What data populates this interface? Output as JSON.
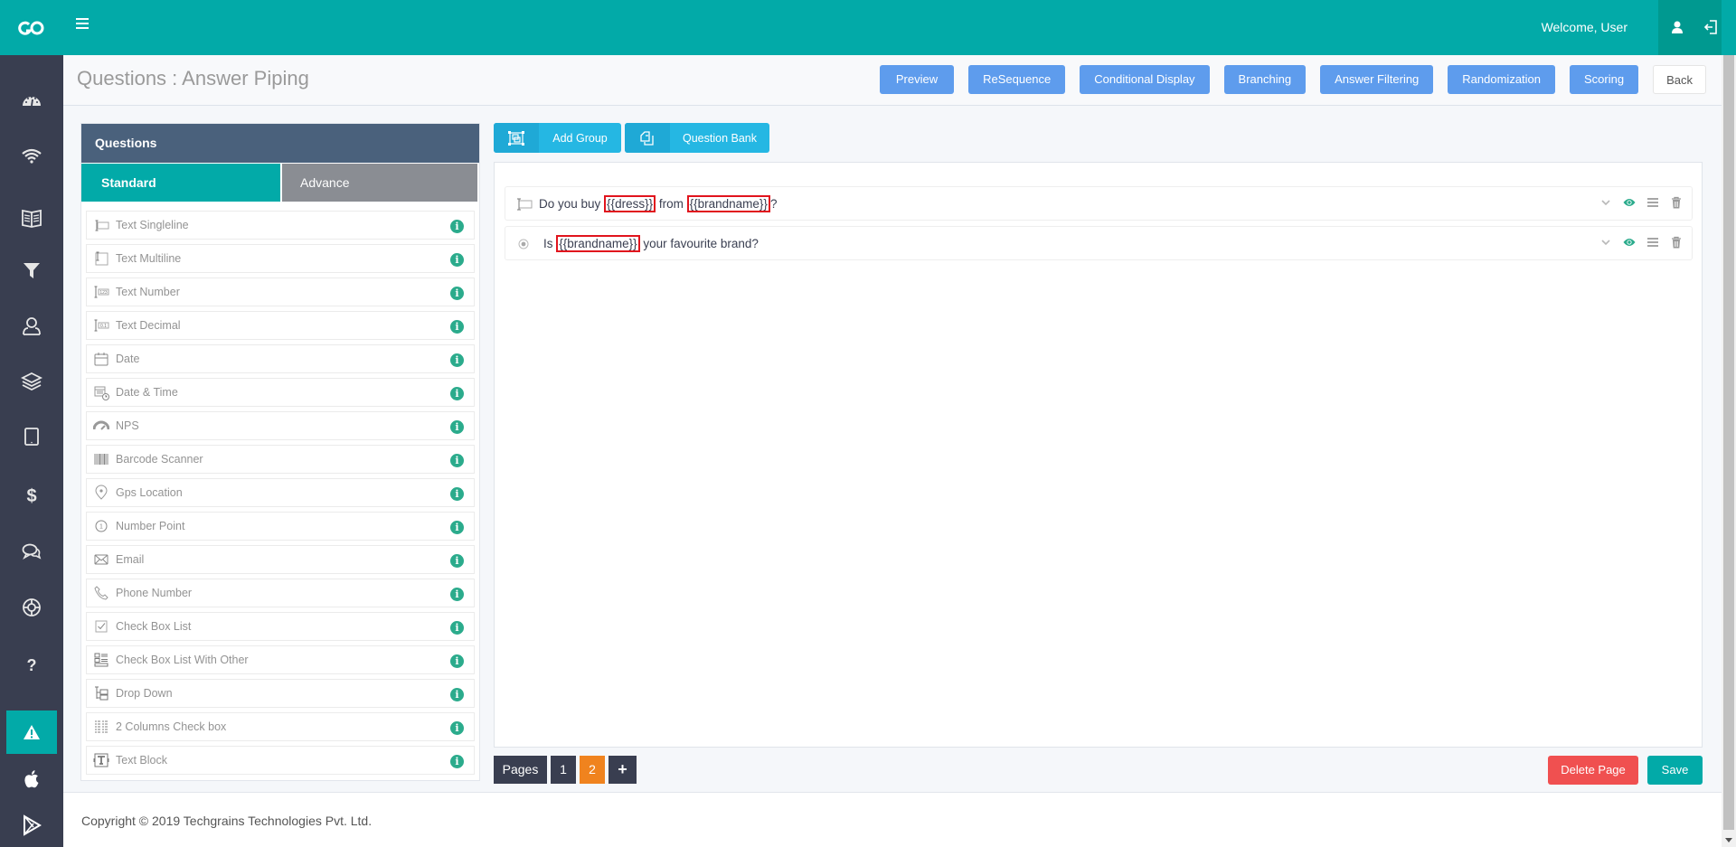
{
  "header": {
    "logo": "go-logo-icon",
    "menu_icon": "hamburger-icon",
    "welcome_text": "Welcome, User",
    "user_icon": "user-icon",
    "logout_icon": "logout-icon"
  },
  "sidebar": {
    "items": [
      {
        "icon": "dashboard-icon"
      },
      {
        "icon": "wifi-icon"
      },
      {
        "icon": "book-icon"
      },
      {
        "icon": "filter-icon"
      },
      {
        "icon": "user-icon"
      },
      {
        "icon": "layers-icon"
      },
      {
        "icon": "tablet-icon"
      },
      {
        "icon": "dollar-icon"
      },
      {
        "icon": "chat-icon"
      },
      {
        "icon": "lifebuoy-icon"
      },
      {
        "icon": "question-icon"
      },
      {
        "icon": "warning-icon",
        "active": true
      },
      {
        "icon": "apple-icon"
      },
      {
        "icon": "play-store-icon"
      }
    ]
  },
  "page": {
    "title": "Questions : Answer Piping"
  },
  "actions": {
    "preview": "Preview",
    "resequence": "ReSequence",
    "conditional_display": "Conditional Display",
    "branching": "Branching",
    "answer_filtering": "Answer Filtering",
    "randomization": "Randomization",
    "scoring": "Scoring",
    "back": "Back"
  },
  "questions_panel": {
    "title": "Questions",
    "tabs": [
      {
        "label": "Standard",
        "active": true
      },
      {
        "label": "Advance",
        "active": false
      }
    ],
    "items": [
      {
        "label": "Text Singleline",
        "icon": "text-singleline-icon"
      },
      {
        "label": "Text Multiline",
        "icon": "text-multiline-icon"
      },
      {
        "label": "Text Number",
        "icon": "text-number-icon"
      },
      {
        "label": "Text Decimal",
        "icon": "text-decimal-icon"
      },
      {
        "label": "Date",
        "icon": "calendar-icon"
      },
      {
        "label": "Date & Time",
        "icon": "calendar-clock-icon"
      },
      {
        "label": "NPS",
        "icon": "gauge-icon"
      },
      {
        "label": "Barcode Scanner",
        "icon": "barcode-icon"
      },
      {
        "label": "Gps Location",
        "icon": "map-pin-icon"
      },
      {
        "label": "Number Point",
        "icon": "number-point-icon"
      },
      {
        "label": "Email",
        "icon": "envelope-icon"
      },
      {
        "label": "Phone Number",
        "icon": "phone-icon"
      },
      {
        "label": "Check Box List",
        "icon": "checkbox-icon"
      },
      {
        "label": "Check Box List With Other",
        "icon": "checklist-other-icon"
      },
      {
        "label": "Drop Down",
        "icon": "dropdown-icon"
      },
      {
        "label": "2 Columns Check box",
        "icon": "two-column-checkbox-icon"
      },
      {
        "label": "Text Block",
        "icon": "text-block-icon"
      }
    ]
  },
  "toolbar": {
    "add_group": "Add Group",
    "question_bank": "Question Bank"
  },
  "survey_questions": [
    {
      "type_icon": "text-singleline-icon",
      "parts": [
        {
          "text": "Do you buy ",
          "pipe": false
        },
        {
          "text": "{{dress}}",
          "pipe": true
        },
        {
          "text": " from ",
          "pipe": false
        },
        {
          "text": "{{brandname}}",
          "pipe": true
        },
        {
          "text": "?",
          "pipe": false
        }
      ]
    },
    {
      "type_icon": "radio-icon",
      "parts": [
        {
          "text": "Is ",
          "pipe": false
        },
        {
          "text": "{{brandname}}",
          "pipe": true
        },
        {
          "text": " your favourite brand?",
          "pipe": false
        }
      ]
    }
  ],
  "pagination": {
    "label": "Pages",
    "pages": [
      "1",
      "2"
    ],
    "active_page": "2",
    "add": "+"
  },
  "page_actions": {
    "delete_page": "Delete Page",
    "save": "Save"
  },
  "footer": {
    "copyright": "Copyright © 2019 Techgrains Technologies Pvt. Ltd."
  },
  "colors": {
    "brand_teal": "#02aaa8",
    "sidebar": "#393e50",
    "action_blue": "#5e9ced",
    "tool_blue": "#25b7e3",
    "pipe_highlight": "#e1141d",
    "active_page": "#f0831e",
    "delete": "#f05050",
    "info_green": "#2bab8c"
  }
}
